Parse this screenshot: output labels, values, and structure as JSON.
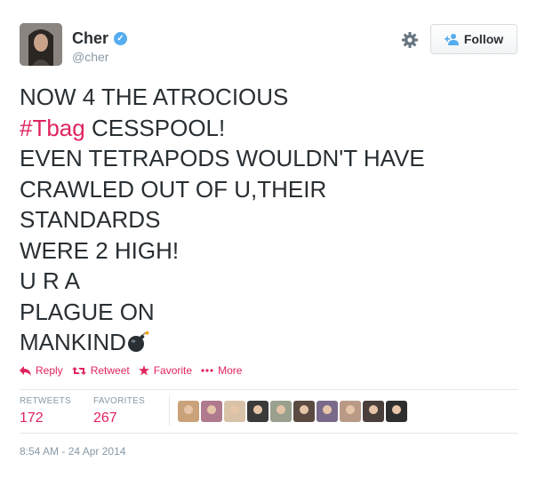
{
  "profile": {
    "name": "Cher",
    "handle": "@cher",
    "verified_icon": "verified-badge-icon"
  },
  "follow_button": {
    "label": "Follow",
    "icon": "add-user-icon"
  },
  "settings_icon": "gear-icon",
  "tweet": {
    "lines": [
      "NOW 4 THE ATROCIOUS",
      "CESSPOOL!",
      "EVEN TETRAPODS WOULDN'T HAVE",
      "CRAWLED OUT OF U,THEIR",
      "STANDARDS",
      "WERE 2 HIGH!",
      "U R A",
      "PLAGUE ON",
      "MANKIND"
    ],
    "hashtag": "#Tbag",
    "emoji": "bomb-icon"
  },
  "actions": {
    "reply": "Reply",
    "retweet": "Retweet",
    "favorite": "Favorite",
    "more": "More"
  },
  "stats": {
    "retweets_label": "RETWEETS",
    "retweets_value": "172",
    "favorites_label": "FAVORITES",
    "favorites_value": "267"
  },
  "favorited_by_avatars": 10,
  "timestamp": "8:54 AM - 24 Apr 2014",
  "colors": {
    "accent": "#e0245e",
    "verified": "#55acee",
    "muted": "#8899a6",
    "text": "#292f33"
  }
}
